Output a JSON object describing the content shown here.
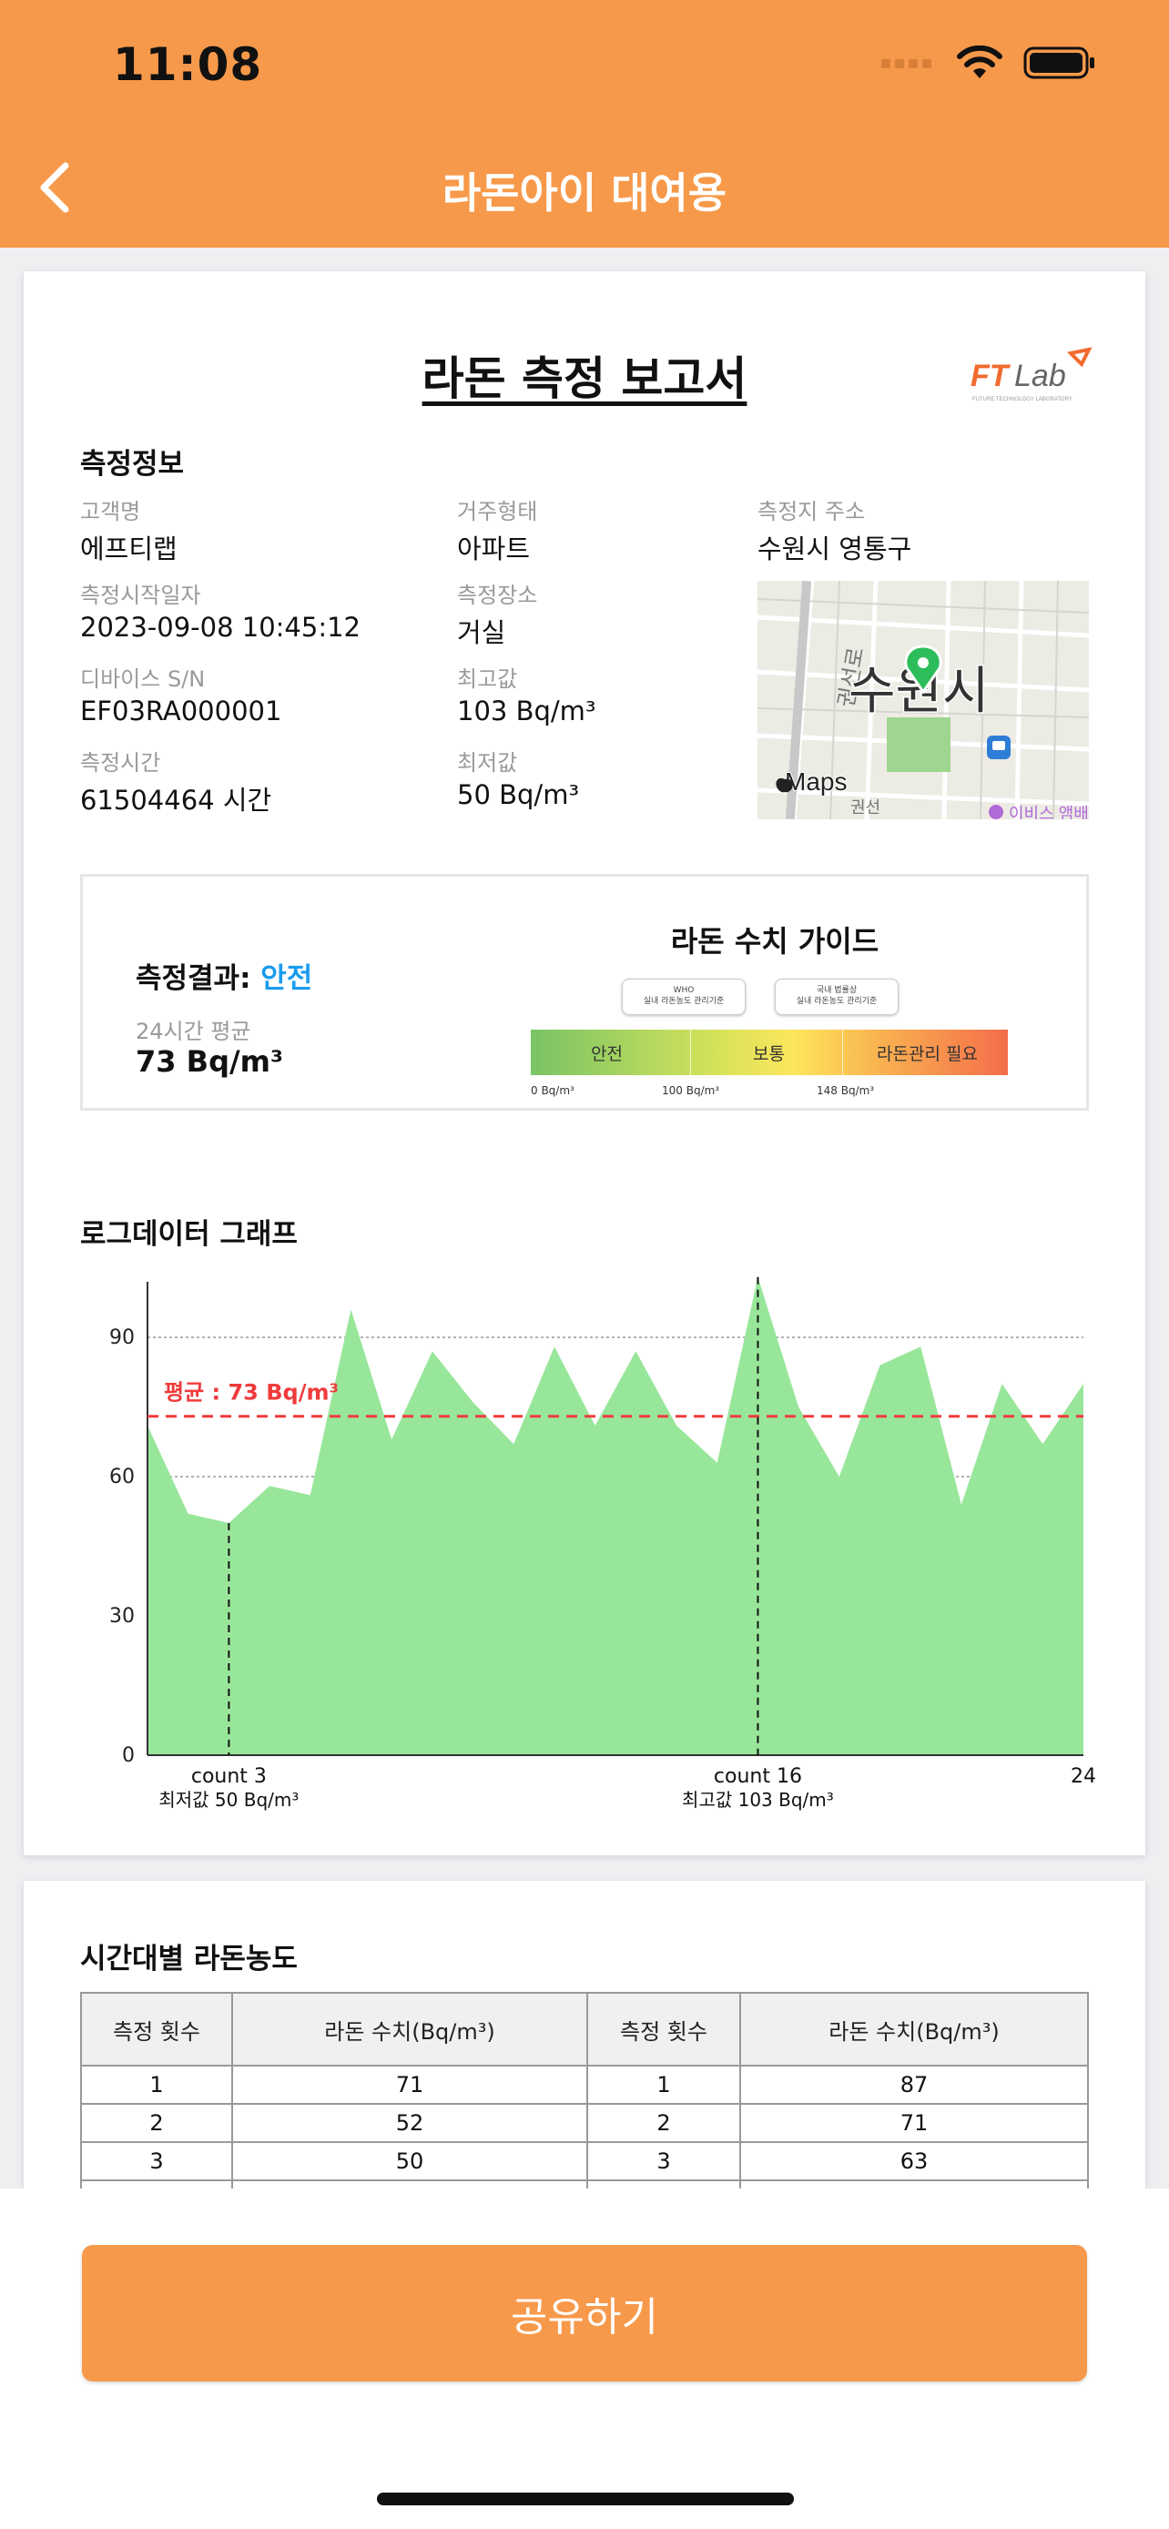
{
  "status": {
    "time": "11:08"
  },
  "nav": {
    "title": "라돈아이 대여용"
  },
  "report": {
    "title": "라돈 측정 보고서",
    "logo_text": "FTLab",
    "logo_sub": "FUTURE TECHNOLOGY LABORATORY"
  },
  "info": {
    "heading": "측정정보",
    "customer_label": "고객명",
    "customer": "에프티랩",
    "housing_label": "거주형태",
    "housing": "아파트",
    "address_label": "측정지 주소",
    "address": "수원시 영통구",
    "start_label": "측정시작일자",
    "start": "2023-09-08 10:45:12",
    "place_label": "측정장소",
    "place": "거실",
    "device_label": "디바이스 S/N",
    "device": "EF03RA000001",
    "max_label": "최고값",
    "max": "103 Bq/m³",
    "duration_label": "측정시간",
    "duration": "61504464 시간",
    "min_label": "최저값",
    "min": "50 Bq/m³"
  },
  "map": {
    "city": "수원시",
    "brand": "Maps",
    "road": "권선로",
    "road2": "권선",
    "poi": "이비스 앰배"
  },
  "result": {
    "label": "측정결과:",
    "value": "안전",
    "avg_label": "24시간 평균",
    "avg": "73 Bq/m³",
    "guide_title": "라돈 수치 가이드",
    "seg_safe": "안전",
    "seg_normal": "보통",
    "seg_danger": "라돈관리 필요",
    "tick0": "0 Bq/m³",
    "tick1": "100 Bq/m³",
    "tick2": "148 Bq/m³",
    "who_l1": "WHO",
    "who_l2": "실내 라돈농도 관리기준",
    "kr_l1": "국내 법률상",
    "kr_l2": "실내 라돈농도 관리기준"
  },
  "graph": {
    "heading": "로그데이터 그래프"
  },
  "chart_data": {
    "type": "area",
    "x": [
      1,
      2,
      3,
      4,
      5,
      6,
      7,
      8,
      9,
      10,
      11,
      12,
      13,
      14,
      15,
      16,
      17,
      18,
      19,
      20,
      21,
      22,
      23,
      24
    ],
    "values": [
      71,
      52,
      50,
      58,
      56,
      96,
      68,
      87,
      76,
      67,
      88,
      71,
      87,
      71,
      63,
      103,
      75,
      60,
      84,
      88,
      54,
      80,
      67,
      80
    ],
    "ylim": [
      0,
      100
    ],
    "yticks": [
      0,
      30,
      60,
      90
    ],
    "average": 73,
    "average_label": "평균 : 73 Bq/m³",
    "min_marker": {
      "x": 3,
      "label1": "count 3",
      "label2": "최저값 50 Bq/m³"
    },
    "max_marker": {
      "x": 16,
      "label1": "count 16",
      "label2": "최고값 103 Bq/m³"
    },
    "x_end_label": "24",
    "fill_color": "#98e69a",
    "avg_color": "#ef3b3b"
  },
  "table": {
    "heading": "시간대별 라돈농도",
    "col1": "측정 횟수",
    "col2": "라돈 수치(Bq/m³)",
    "col3": "측정 횟수",
    "col4": "라돈 수치(Bq/m³)",
    "rows": [
      [
        "1",
        "71",
        "1",
        "87"
      ],
      [
        "2",
        "52",
        "2",
        "71"
      ],
      [
        "3",
        "50",
        "3",
        "63"
      ]
    ]
  },
  "share": {
    "label": "공유하기"
  }
}
